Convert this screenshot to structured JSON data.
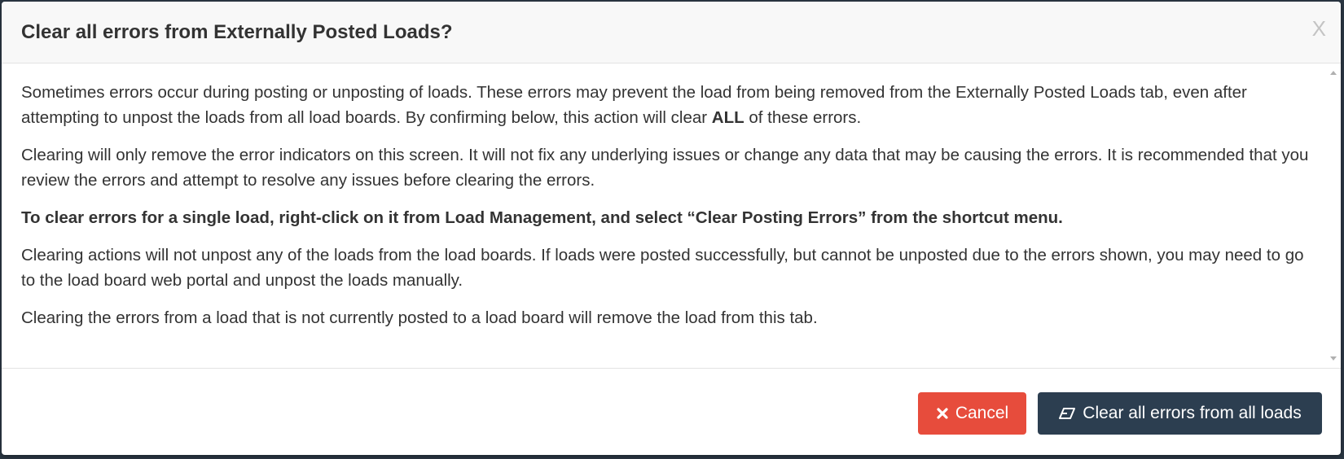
{
  "modal": {
    "title": "Clear all errors from Externally Posted Loads?",
    "close_label": "X"
  },
  "body": {
    "p1_text": "Sometimes errors occur during posting or unposting of loads. These errors may prevent the load from being removed from the Externally Posted Loads tab, even after attempting to unpost the loads from all load boards. By confirming below, this action will clear ",
    "p1_bold": "ALL",
    "p1_tail": " of these errors.",
    "p2": "Clearing will only remove the error indicators on this screen. It will not fix any underlying issues or change any data that may be causing the errors. It is recommended that you review the errors and attempt to resolve any issues before clearing the errors.",
    "p3": "To clear errors for a single load, right-click on it from Load Management, and select “Clear Posting Errors” from the shortcut menu.",
    "p4": "Clearing actions will not unpost any of the loads from the load boards. If loads were posted successfully, but cannot be unposted due to the errors shown, you may need to go to the load board web portal and unpost the loads manually.",
    "p5": "Clearing the errors from a load that is not currently posted to a load board will remove the load from this tab."
  },
  "footer": {
    "cancel_label": "Cancel",
    "cancel_icon": "close-icon",
    "clear_label": "Clear all errors from all loads",
    "clear_icon": "eraser-icon"
  },
  "colors": {
    "cancel_bg": "#e74c3c",
    "clear_bg": "#2c3e50",
    "header_bg": "#f8f8f8",
    "text": "#333333"
  }
}
